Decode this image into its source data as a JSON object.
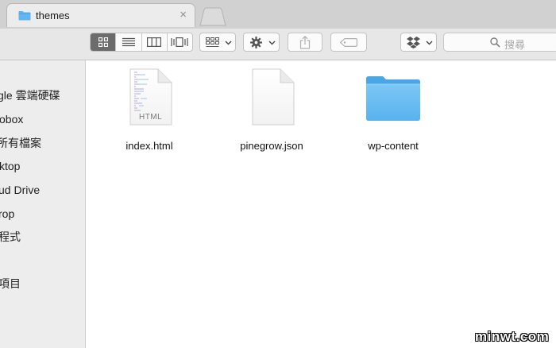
{
  "tab": {
    "title": "themes",
    "close_glyph": "×"
  },
  "toolbar": {
    "view_buttons": [
      "icon-view",
      "list-view",
      "column-view",
      "cover-flow-view"
    ],
    "search_placeholder": "搜尋"
  },
  "sidebar": {
    "items": [
      "gle 雲端硬碟",
      "obox",
      "所有檔案",
      "ktop",
      "ud Drive",
      "rop",
      "程式",
      "",
      "項目",
      "",
      ""
    ]
  },
  "files": [
    {
      "name": "index.html",
      "kind": "html-document-icon",
      "badge": "HTML"
    },
    {
      "name": "pinegrow.json",
      "kind": "json-document-icon"
    },
    {
      "name": "wp-content",
      "kind": "folder-icon"
    }
  ],
  "watermark": "minwt.com",
  "colors": {
    "folder": "#5fb6f0",
    "active_segment": "#6c6c6c"
  }
}
